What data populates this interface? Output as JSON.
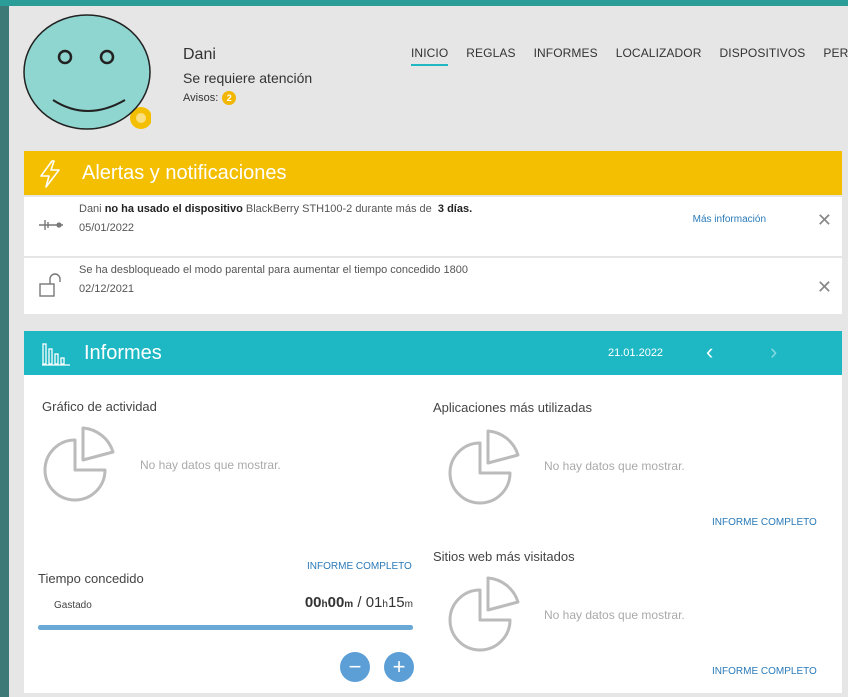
{
  "profile": {
    "name": "Dani",
    "status": "Se requiere atención",
    "avisos_label": "Avisos:",
    "avisos_count": "2"
  },
  "nav": [
    "INICIO",
    "REGLAS",
    "INFORMES",
    "LOCALIZADOR",
    "DISPOSITIVOS",
    "PERFIL"
  ],
  "nav_active": "INICIO",
  "alerts": {
    "title": "Alertas y notificaciones",
    "items": [
      {
        "text_name": "Dani",
        "text_bold": "no ha usado el dispositivo",
        "text_mid": "BlackBerry STH100-2 durante más de",
        "text_days": "3 días.",
        "date": "05/01/2022",
        "more_info": "Más información",
        "icon": "device-unused-icon"
      },
      {
        "text": "Se ha desbloqueado el modo parental para aumentar el tiempo concedido 1800",
        "date": "02/12/2021",
        "icon": "unlock-icon"
      }
    ],
    "close_glyph": "✕"
  },
  "reports": {
    "title": "Informes",
    "date": "21.01.2022",
    "prev": "‹",
    "next": "›",
    "activity_title": "Gráfico de actividad",
    "apps_title": "Aplicaciones más utilizadas",
    "sites_title": "Sitios web más visitados",
    "no_data": "No hay datos que mostrar.",
    "full_report": "INFORME COMPLETO",
    "time_title": "Tiempo concedido",
    "spent_label": "Gastado",
    "spent_h": "00",
    "spent_m": "00",
    "allowed_h": "01",
    "allowed_m": "15",
    "h_unit": "h",
    "m_unit": "m",
    "separator": " / ",
    "minus": "−",
    "plus": "+"
  },
  "colors": {
    "accent_yellow": "#f4bf00",
    "accent_teal": "#1eb8c5",
    "link": "#2a7ab8",
    "avatar": "#8fd6d0"
  }
}
